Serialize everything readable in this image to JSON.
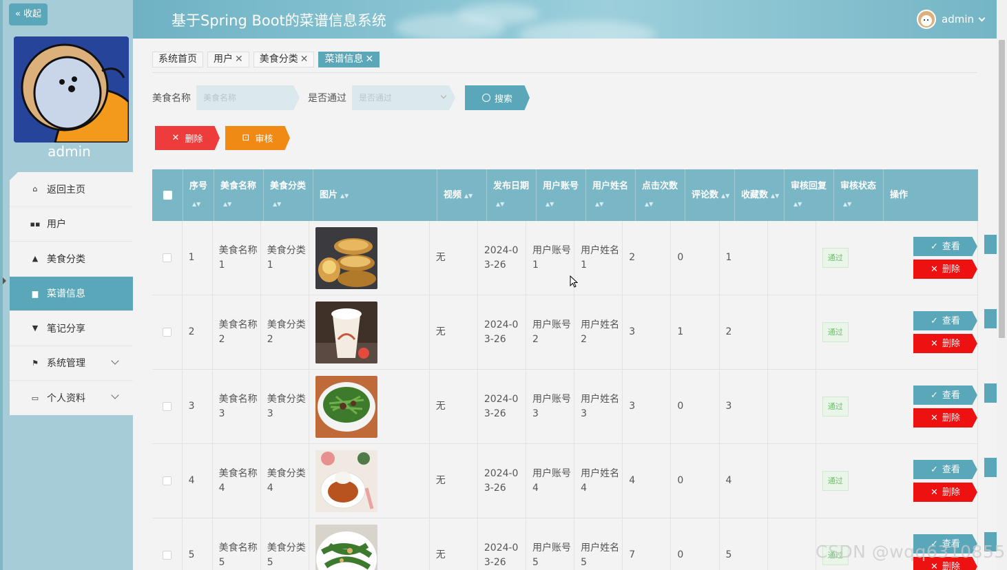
{
  "sidebar": {
    "collapse_label": "« 收起",
    "user_name": "admin",
    "items": [
      {
        "label": "返回主页",
        "icon": "home-icon"
      },
      {
        "label": "用户",
        "icon": "grid-icon"
      },
      {
        "label": "美食分类",
        "icon": "person-icon"
      },
      {
        "label": "菜谱信息",
        "icon": "clipboard-icon",
        "active": true
      },
      {
        "label": "笔记分享",
        "icon": "note-icon"
      },
      {
        "label": "系统管理",
        "icon": "flag-icon",
        "expandable": true
      },
      {
        "label": "个人资料",
        "icon": "card-icon",
        "expandable": true
      }
    ]
  },
  "header": {
    "title": "基于Spring Boot的菜谱信息系统",
    "user": "admin"
  },
  "tabs": [
    {
      "label": "系统首页",
      "closable": false
    },
    {
      "label": "用户",
      "closable": true
    },
    {
      "label": "美食分类",
      "closable": true
    },
    {
      "label": "菜谱信息",
      "closable": true,
      "active": true
    }
  ],
  "search": {
    "name_label": "美食名称",
    "name_placeholder": "美食名称",
    "pass_label": "是否通过",
    "pass_placeholder": "是否通过",
    "search_button": "搜索"
  },
  "actions": {
    "delete_label": "删除",
    "audit_label": "审核"
  },
  "table": {
    "columns": [
      "序号",
      "美食名称",
      "美食分类",
      "图片",
      "视频",
      "发布日期",
      "用户账号",
      "用户姓名",
      "点击次数",
      "评论数",
      "收藏数",
      "审核回复",
      "审核状态",
      "操作"
    ],
    "view_label": "查看",
    "delete_label": "删除",
    "rows": [
      {
        "index": "1",
        "name": "美食名称1",
        "category": "美食分类1",
        "video": "无",
        "date": "2024-03-26",
        "account": "用户账号1",
        "username": "用户姓名1",
        "clicks": "2",
        "comments": "0",
        "favorites": "1",
        "reply": "",
        "status": "通过"
      },
      {
        "index": "2",
        "name": "美食名称2",
        "category": "美食分类2",
        "video": "无",
        "date": "2024-03-26",
        "account": "用户账号2",
        "username": "用户姓名2",
        "clicks": "3",
        "comments": "1",
        "favorites": "2",
        "reply": "",
        "status": "通过"
      },
      {
        "index": "3",
        "name": "美食名称3",
        "category": "美食分类3",
        "video": "无",
        "date": "2024-03-26",
        "account": "用户账号3",
        "username": "用户姓名3",
        "clicks": "3",
        "comments": "0",
        "favorites": "3",
        "reply": "",
        "status": "通过"
      },
      {
        "index": "4",
        "name": "美食名称4",
        "category": "美食分类4",
        "video": "无",
        "date": "2024-03-26",
        "account": "用户账号4",
        "username": "用户姓名4",
        "clicks": "4",
        "comments": "0",
        "favorites": "4",
        "reply": "",
        "status": "通过"
      },
      {
        "index": "5",
        "name": "美食名称5",
        "category": "美食分类5",
        "video": "无",
        "date": "2024-03-26",
        "account": "用户账号5",
        "username": "用户姓名5",
        "clicks": "7",
        "comments": "0",
        "favorites": "5",
        "reply": "",
        "status": "通过"
      }
    ]
  },
  "watermark": "CSDN @wqq6310855",
  "colors": {
    "accent": "#5aa7ba",
    "danger": "#ee3b3b",
    "warning": "#f08a14",
    "success": "#6bbf6b"
  }
}
